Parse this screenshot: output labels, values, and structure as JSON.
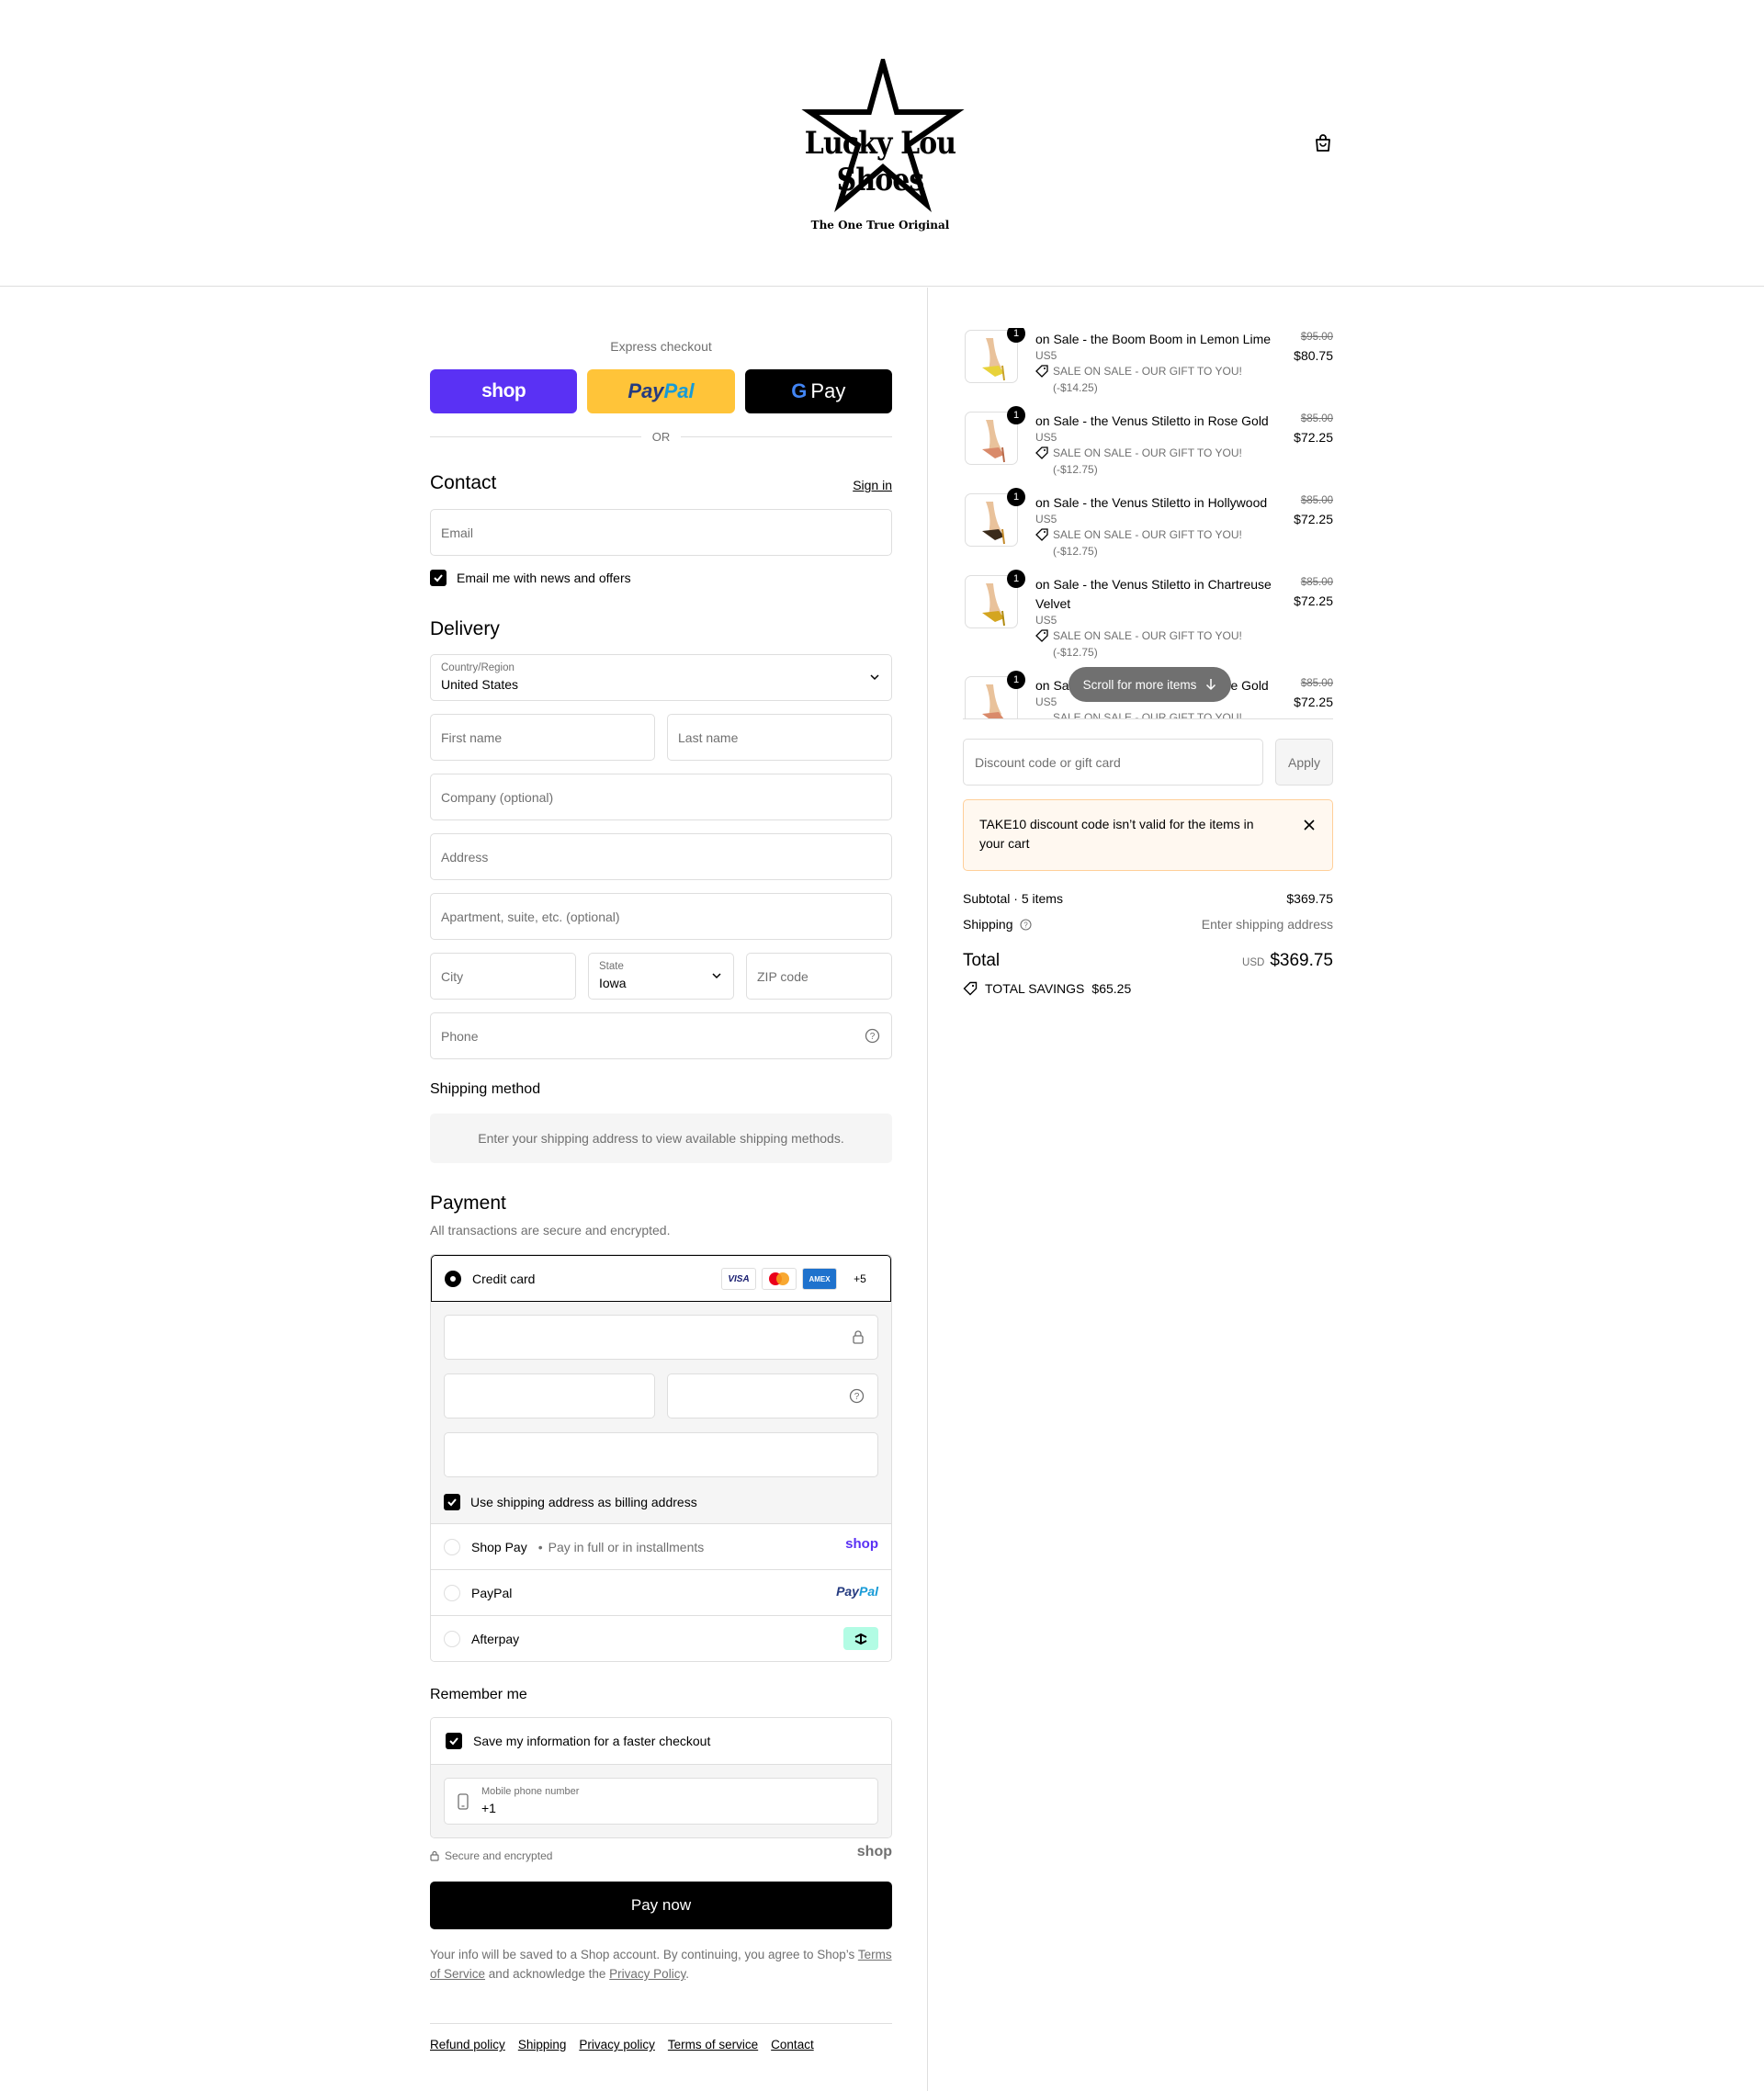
{
  "brand": {
    "name": "Lucky Lou Shoes",
    "tagline": "The One True Original"
  },
  "express": {
    "title": "Express checkout",
    "shop_label": "shop",
    "paypal_label_1": "Pay",
    "paypal_label_2": "Pal",
    "gpay_label": "Pay",
    "or_label": "OR"
  },
  "contact": {
    "title": "Contact",
    "sign_in": "Sign in",
    "email_placeholder": "Email",
    "news_label": "Email me with news and offers"
  },
  "delivery": {
    "title": "Delivery",
    "country_label": "Country/Region",
    "country_value": "United States",
    "first_name": "First name",
    "last_name": "Last name",
    "company": "Company (optional)",
    "address": "Address",
    "apartment": "Apartment, suite, etc. (optional)",
    "city": "City",
    "state_label": "State",
    "state_value": "Iowa",
    "zip": "ZIP code",
    "phone": "Phone"
  },
  "shipping_method": {
    "title": "Shipping method",
    "message": "Enter your shipping address to view available shipping methods."
  },
  "payment": {
    "title": "Payment",
    "subtitle": "All transactions are secure and encrypted.",
    "credit_card": "Credit card",
    "more_cards": "+5",
    "visa": "VISA",
    "amex": "AMEX",
    "billing_label": "Use shipping address as billing address",
    "shop_pay": "Shop Pay",
    "shop_pay_sub": "Pay in full or in installments",
    "shop_pay_logo": "shop",
    "paypal": "PayPal",
    "paypal_logo_1": "Pay",
    "paypal_logo_2": "Pal",
    "afterpay": "Afterpay"
  },
  "remember": {
    "title": "Remember me",
    "save_label": "Save my information for a faster checkout",
    "mobile_label": "Mobile phone number",
    "mobile_value": "+1",
    "secure": "Secure and encrypted",
    "shop_logo": "shop"
  },
  "pay_now": "Pay now",
  "legal": {
    "text_1": "Your info will be saved to a Shop account. By continuing, you agree to Shop’s",
    "tos": "Terms of Service",
    "text_2": "and acknowledge the",
    "privacy": "Privacy Policy",
    "text_3": "."
  },
  "footer": [
    "Refund policy",
    "Shipping",
    "Privacy policy",
    "Terms of service",
    "Contact"
  ],
  "cart": {
    "items": [
      {
        "qty": "1",
        "name": "on Sale - the Boom Boom in Lemon Lime",
        "variant": "US5",
        "discount": "SALE ON SALE - OUR GIFT TO YOU!",
        "discount_amt": "(-$14.25)",
        "old_price": "$95.00",
        "price": "$80.75"
      },
      {
        "qty": "1",
        "name": "on Sale - the Venus Stiletto in Rose Gold",
        "variant": "US5",
        "discount": "SALE ON SALE - OUR GIFT TO YOU!",
        "discount_amt": "(-$12.75)",
        "old_price": "$85.00",
        "price": "$72.25"
      },
      {
        "qty": "1",
        "name": "on Sale - the Venus Stiletto in Hollywood",
        "variant": "US5",
        "discount": "SALE ON SALE - OUR GIFT TO YOU!",
        "discount_amt": "(-$12.75)",
        "old_price": "$85.00",
        "price": "$72.25"
      },
      {
        "qty": "1",
        "name": "on Sale - the Venus Stiletto in Chartreuse Velvet",
        "variant": "US5",
        "discount": "SALE ON SALE - OUR GIFT TO YOU!",
        "discount_amt": "(-$12.75)",
        "old_price": "$85.00",
        "price": "$72.25"
      },
      {
        "qty": "1",
        "name": "on Sale - the Venus Stiletto in Rose Gold",
        "variant": "US5",
        "discount": "SALE ON SALE - OUR GIFT TO YOU!",
        "discount_amt": "",
        "old_price": "$85.00",
        "price": "$72.25"
      }
    ],
    "scroll_hint": "Scroll for more items",
    "discount_placeholder": "Discount code or gift card",
    "apply": "Apply",
    "alert": "TAKE10 discount code isn’t valid for the items in your cart",
    "subtotal_label": "Subtotal · 5 items",
    "subtotal_value": "$369.75",
    "shipping_label": "Shipping",
    "shipping_value": "Enter shipping address",
    "total_label": "Total",
    "currency": "USD",
    "total_value": "$369.75",
    "savings_label": "TOTAL SAVINGS",
    "savings_value": "$65.25"
  }
}
